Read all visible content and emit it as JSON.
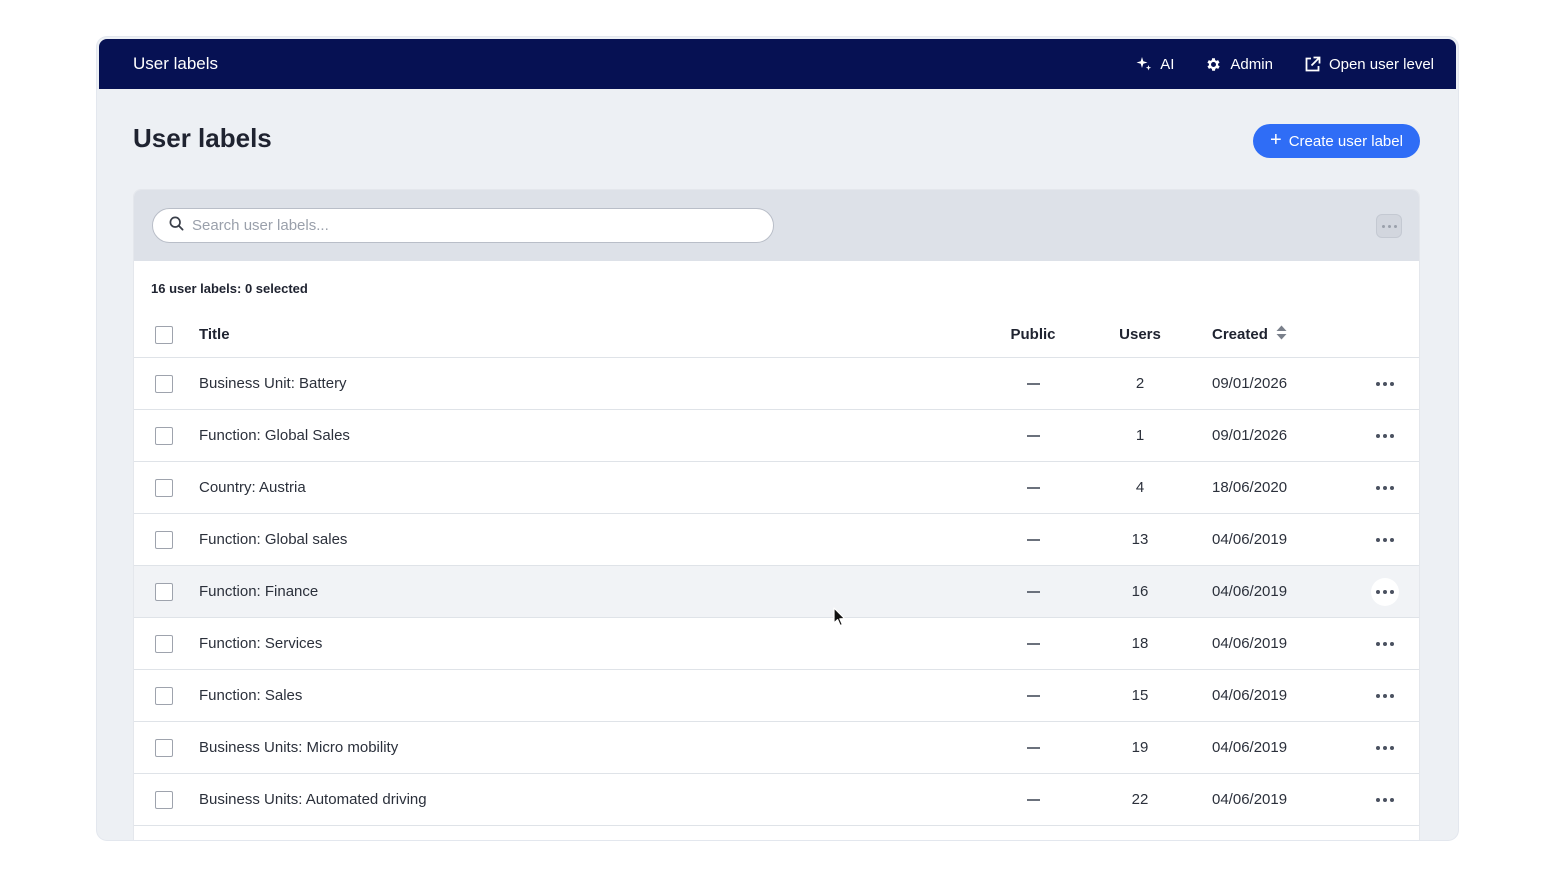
{
  "topbar": {
    "title": "User labels",
    "actions": [
      {
        "label": "AI",
        "icon": "sparkle-icon"
      },
      {
        "label": "Admin",
        "icon": "gear-icon"
      },
      {
        "label": "Open user level",
        "icon": "external-link-icon"
      }
    ]
  },
  "page": {
    "title": "User labels",
    "create_button": "Create user label"
  },
  "search": {
    "placeholder": "Search user labels..."
  },
  "summary": "16 user labels: 0 selected",
  "table": {
    "columns": {
      "title": "Title",
      "public": "Public",
      "users": "Users",
      "created": "Created"
    },
    "rows": [
      {
        "title": "Business Unit: Battery",
        "users": "2",
        "created": "09/01/2026"
      },
      {
        "title": "Function: Global Sales",
        "users": "1",
        "created": "09/01/2026"
      },
      {
        "title": "Country: Austria",
        "users": "4",
        "created": "18/06/2020"
      },
      {
        "title": "Function: Global sales",
        "users": "13",
        "created": "04/06/2019"
      },
      {
        "title": "Function: Finance",
        "users": "16",
        "created": "04/06/2019"
      },
      {
        "title": "Function: Services",
        "users": "18",
        "created": "04/06/2019"
      },
      {
        "title": "Function: Sales",
        "users": "15",
        "created": "04/06/2019"
      },
      {
        "title": "Business Units: Micro mobility",
        "users": "19",
        "created": "04/06/2019"
      },
      {
        "title": "Business Units: Automated driving",
        "users": "22",
        "created": "04/06/2019"
      }
    ]
  }
}
